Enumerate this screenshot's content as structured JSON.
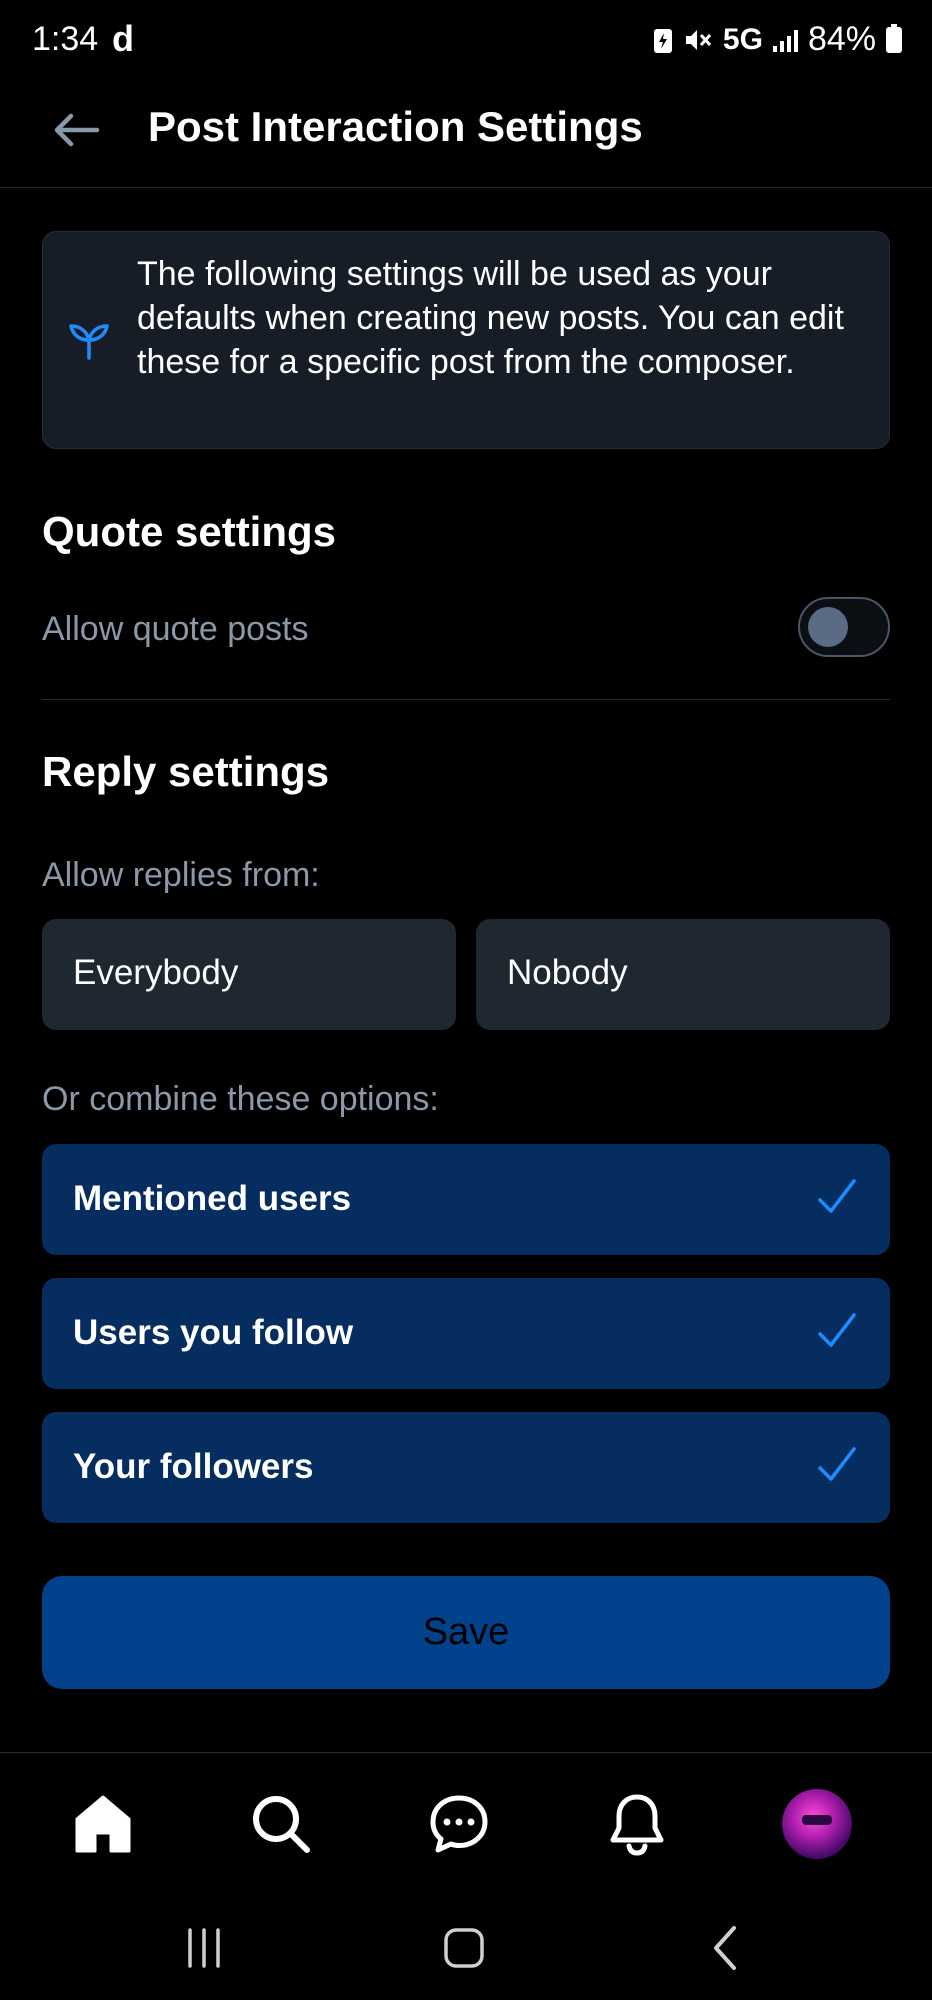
{
  "status_bar": {
    "time": "1:34",
    "app_glyph": "d",
    "network": "5G",
    "battery": "84%"
  },
  "header": {
    "title": "Post Interaction Settings",
    "back_icon": "arrow-left-icon"
  },
  "info": {
    "icon": "sprout-icon",
    "text": "The following settings will be used as your defaults when creating new posts. You can edit these for a specific post from the composer."
  },
  "quote_settings": {
    "title": "Quote settings",
    "allow_label": "Allow quote posts",
    "allow_enabled": false
  },
  "reply_settings": {
    "title": "Reply settings",
    "allow_from_label": "Allow replies from:",
    "choices": [
      {
        "label": "Everybody"
      },
      {
        "label": "Nobody"
      }
    ],
    "combine_label": "Or combine these options:",
    "options": [
      {
        "label": "Mentioned users",
        "checked": true
      },
      {
        "label": "Users you follow",
        "checked": true
      },
      {
        "label": "Your followers",
        "checked": true
      }
    ]
  },
  "save_label": "Save",
  "bottom_nav": {
    "items": [
      "home-icon",
      "search-icon",
      "chat-icon",
      "bell-icon",
      "avatar"
    ]
  },
  "colors": {
    "background": "#000000",
    "accent": "#208bfe",
    "option_bg": "#052d5f",
    "save_bg": "#02418b"
  }
}
